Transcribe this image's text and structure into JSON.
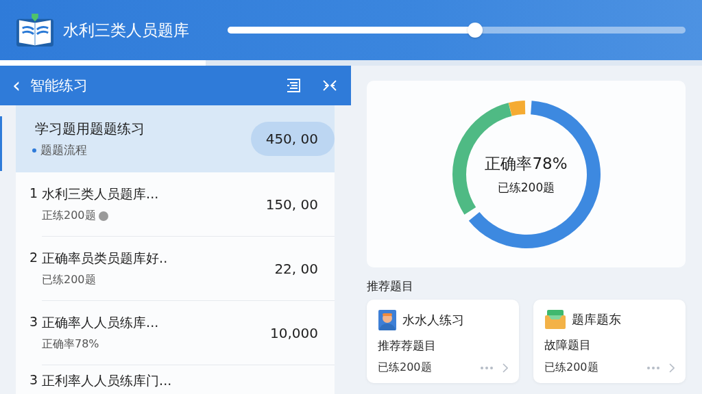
{
  "app": {
    "title": "水利三类人员题库",
    "slider": {
      "level": 0.54
    }
  },
  "panel": {
    "title": "智能练习",
    "back": "‹"
  },
  "featured": {
    "title": "学习题用题题练习",
    "subtitle": "题题流程",
    "value": "450, 00",
    "selected": true
  },
  "rows": [
    {
      "index": "1",
      "title": "水利三类人员题库...",
      "subtitle": "正练200题",
      "info": true,
      "value": "150, 00"
    },
    {
      "index": "2",
      "title": "正确率员类员题库好..",
      "subtitle": "已练200题",
      "info": false,
      "value": "22, 00"
    },
    {
      "index": "3",
      "title": "正确率人人员练库...",
      "subtitle": "正确率78%",
      "info": false,
      "value": "10,000"
    },
    {
      "index": "3",
      "title": "正利率人人员练库门..."
    }
  ],
  "summary": {
    "headline": "正确率78%",
    "caption": "已练200题"
  },
  "recommend": {
    "heading": "推荐题目",
    "cards": [
      {
        "kind": "person",
        "title": "水水人练习",
        "subtitle": "推荐荐题目",
        "count": "已练200题"
      },
      {
        "kind": "folder",
        "title": "题库题东",
        "subtitle": "故障题目",
        "count": "已练200题"
      }
    ]
  }
}
